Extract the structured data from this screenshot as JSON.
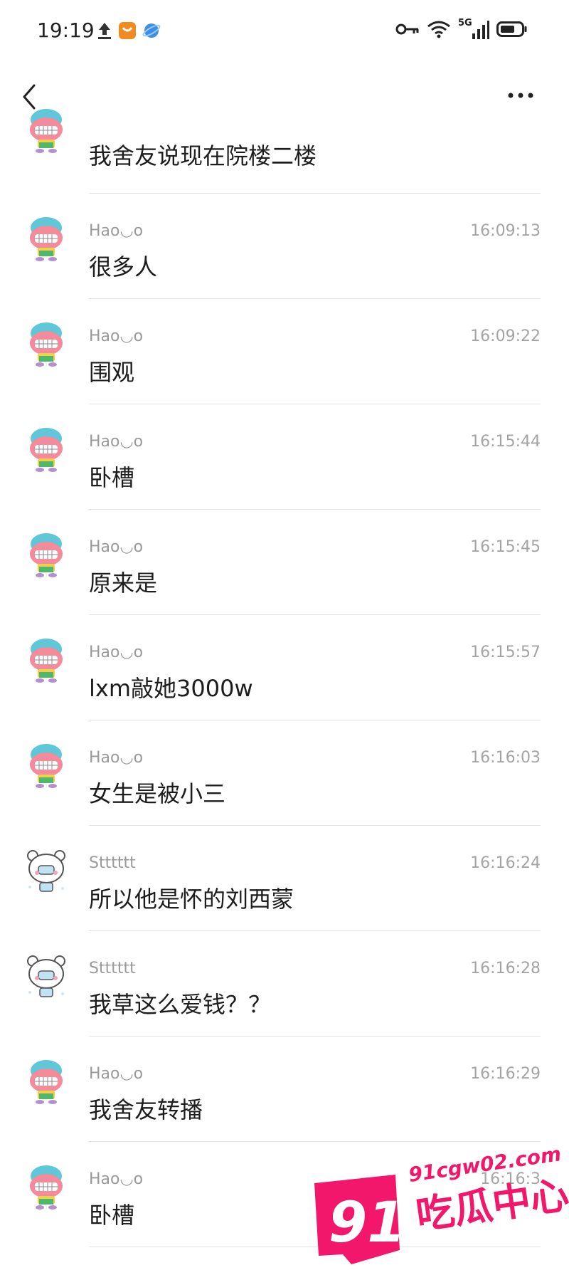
{
  "status_bar": {
    "time": "19:19",
    "left_icons": [
      "upload-icon",
      "shopping-app-icon",
      "browser-icon"
    ],
    "right_icons": [
      "key-icon",
      "wifi-icon",
      "signal-5g-icon",
      "battery-icon"
    ],
    "network": "5G"
  },
  "nav": {
    "back_icon": "chevron-left-icon",
    "more_icon": "more-icon"
  },
  "messages": [
    {
      "sender": "",
      "time": "",
      "text": "我舍友说现在院楼二楼",
      "avatar": "red-mascot"
    },
    {
      "sender": "Hao◡o",
      "time": "16:09:13",
      "text": "很多人",
      "avatar": "red-mascot"
    },
    {
      "sender": "Hao◡o",
      "time": "16:09:22",
      "text": "围观",
      "avatar": "red-mascot"
    },
    {
      "sender": "Hao◡o",
      "time": "16:15:44",
      "text": "卧槽",
      "avatar": "red-mascot"
    },
    {
      "sender": "Hao◡o",
      "time": "16:15:45",
      "text": "原来是",
      "avatar": "red-mascot"
    },
    {
      "sender": "Hao◡o",
      "time": "16:15:57",
      "text": "lxm敲她3000w",
      "avatar": "red-mascot"
    },
    {
      "sender": "Hao◡o",
      "time": "16:16:03",
      "text": "女生是被小三",
      "avatar": "red-mascot"
    },
    {
      "sender": "Stttttt",
      "time": "16:16:24",
      "text": "所以他是怀的刘西蒙",
      "avatar": "bear-mascot"
    },
    {
      "sender": "Stttttt",
      "time": "16:16:28",
      "text": "我草这么爱钱？？",
      "avatar": "bear-mascot"
    },
    {
      "sender": "Hao◡o",
      "time": "16:16:29",
      "text": "我舍友转播",
      "avatar": "red-mascot"
    },
    {
      "sender": "Hao◡o",
      "time": "16:16:3",
      "text": "卧槽",
      "avatar": "red-mascot"
    }
  ],
  "watermark": {
    "number": "91",
    "site": "91cgw02.com",
    "name": "吃瓜中心",
    "color": "#f2176a"
  }
}
